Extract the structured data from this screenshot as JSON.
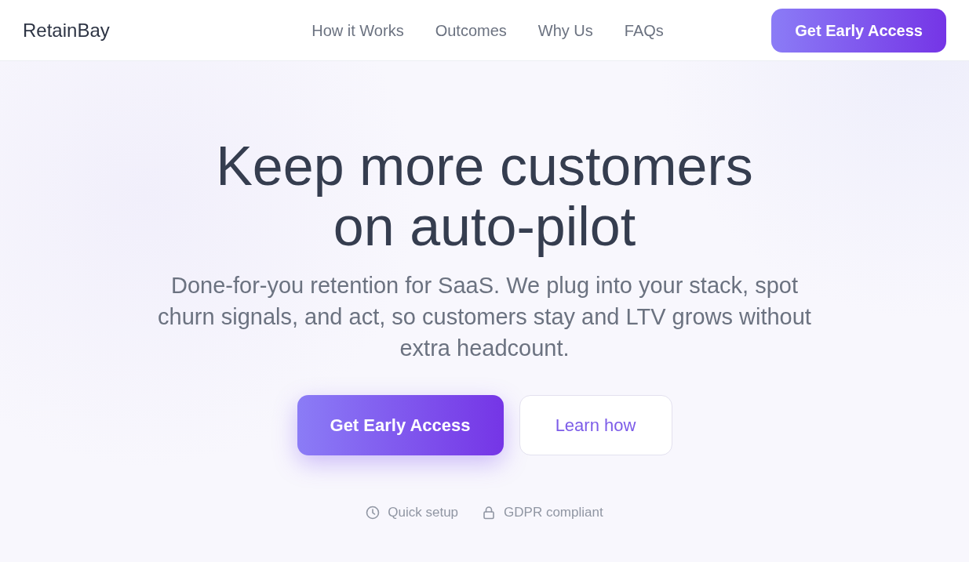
{
  "navbar": {
    "brand": "RetainBay",
    "links": [
      {
        "label": "How it Works"
      },
      {
        "label": "Outcomes"
      },
      {
        "label": "Why Us"
      },
      {
        "label": "FAQs"
      }
    ],
    "cta": "Get Early Access"
  },
  "hero": {
    "title_lines": [
      "Keep more customers",
      "on auto-pilot"
    ],
    "subtitle": "Done-for-you retention for SaaS. We plug into your stack, spot churn signals, and act, so customers stay and LTV grows without extra headcount.",
    "primary_button": "Get Early Access",
    "secondary_button": "Learn how",
    "badges": [
      {
        "kind": "clock",
        "label": "Quick setup"
      },
      {
        "kind": "lock",
        "label": "GDPR compliant"
      }
    ]
  }
}
